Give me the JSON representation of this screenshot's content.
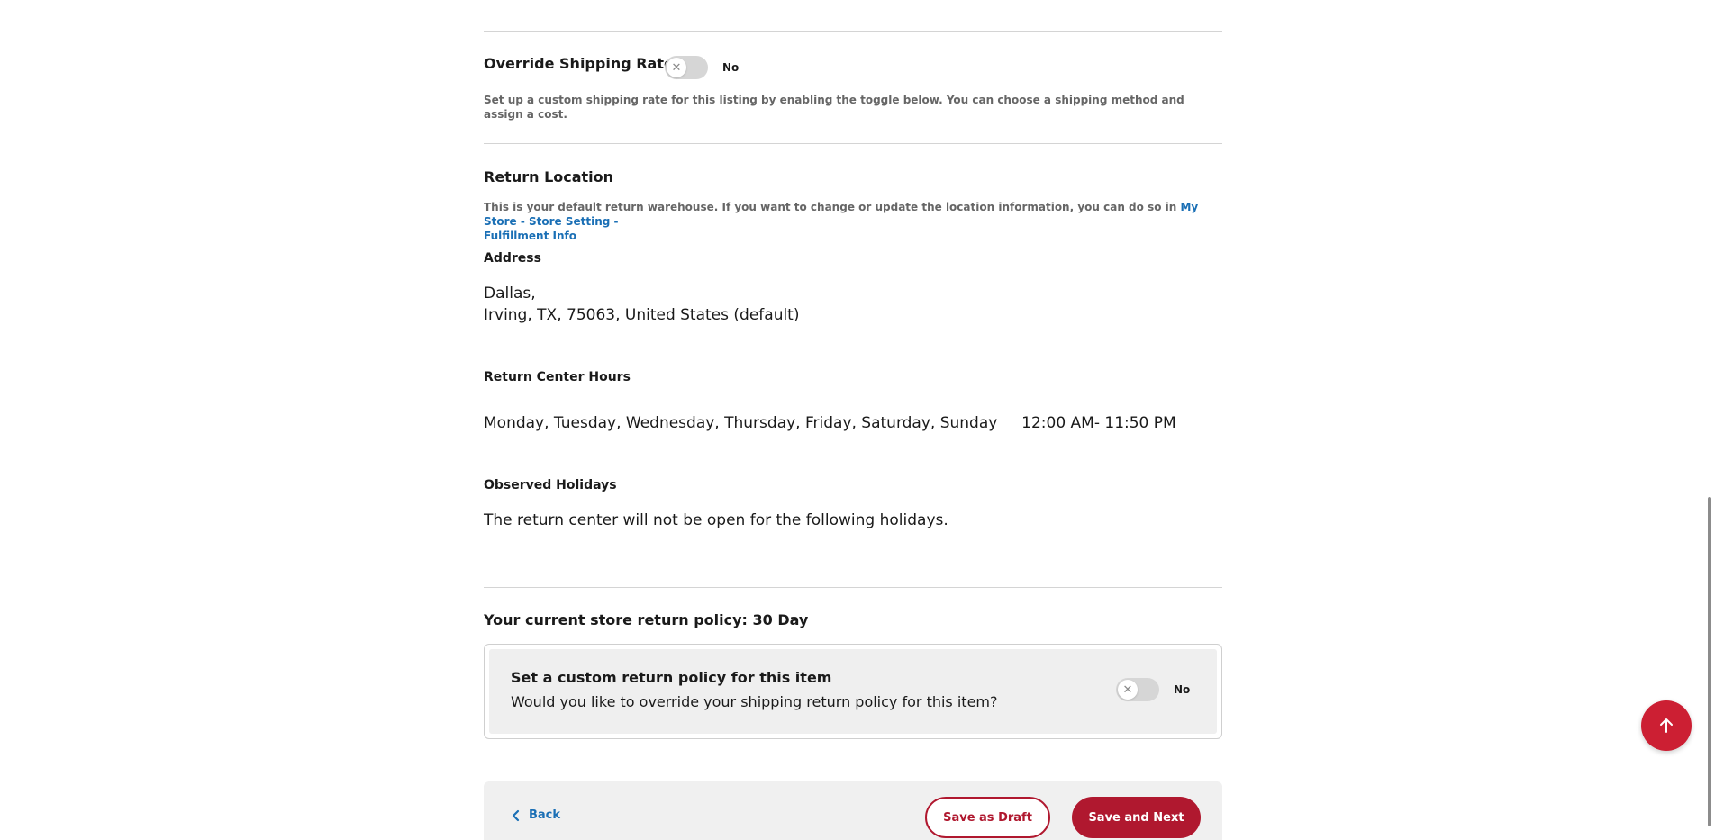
{
  "shipping_override": {
    "title": "Override Shipping Rate",
    "toggle_label": "No",
    "help_text": "Set up a custom shipping rate for this listing by enabling the toggle below. You can choose a shipping method and assign a cost."
  },
  "return_location": {
    "title": "Return Location",
    "help_text": "This is your default return warehouse. If you want to change or update the location information, you can do so in",
    "link_text_line1": "My Store - Store Setting -",
    "link_text_line2": "Fulfillment Info",
    "address_label": "Address",
    "address_line1": "Dallas,",
    "address_line2": "Irving, TX, 75063, United States (default)",
    "hours_label": "Return Center Hours",
    "hours_days": "Monday, Tuesday, Wednesday, Thursday, Friday, Saturday, Sunday",
    "hours_time": "12:00 AM- 11:50 PM",
    "holidays_label": "Observed Holidays",
    "holidays_text": "The return center will not be open for the following holidays."
  },
  "return_policy": {
    "current_label": "Your current store return policy: 30 Day",
    "custom_title": "Set a custom return policy for this item",
    "custom_question": "Would you like to override your shipping return policy for this item?",
    "toggle_label": "No"
  },
  "footer": {
    "back_label": "Back",
    "save_draft_label": "Save as Draft",
    "save_next_label": "Save and Next"
  },
  "colors": {
    "accent_red": "#b0182f",
    "link_blue": "#1a6fb5"
  },
  "icons": {
    "toggle_off": "x-icon",
    "back": "chevron-left-icon",
    "scroll_top": "arrow-up-icon"
  }
}
